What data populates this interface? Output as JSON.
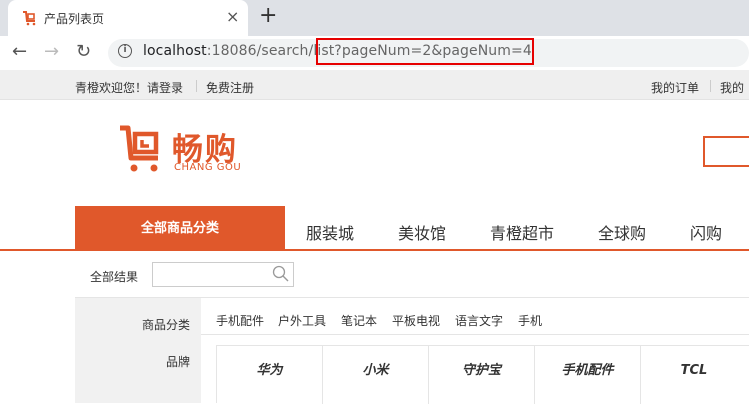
{
  "browser": {
    "tab_title": "产品列表页",
    "close_glyph": "×",
    "new_tab_glyph": "+",
    "url_host": "localhost",
    "url_rest": ":18086/search/list?pageNum=2&pageNum=4",
    "icons": [
      "back-arrow-icon",
      "forward-arrow-icon",
      "reload-icon",
      "info-icon",
      "close-icon",
      "plus-icon"
    ]
  },
  "site_top": {
    "welcome": "青橙欢迎您！",
    "login": "请登录",
    "register": "免费注册",
    "my_orders": "我的订单",
    "my_more": "我的"
  },
  "logo": {
    "cn": "畅购",
    "en": "CHANG GOU",
    "color": "#e0582b"
  },
  "nav": {
    "all_categories": "全部商品分类",
    "links": [
      "服装城",
      "美妆馆",
      "青橙超市",
      "全球购",
      "闪购"
    ]
  },
  "search": {
    "label": "全部结果",
    "value": ""
  },
  "filters": {
    "category_label": "商品分类",
    "categories": [
      "手机配件",
      "户外工具",
      "笔记本",
      "平板电视",
      "语言文字",
      "手机"
    ],
    "brand_label": "品牌",
    "brands": [
      "华为",
      "小米",
      "守护宝",
      "手机配件",
      "TCL"
    ]
  }
}
